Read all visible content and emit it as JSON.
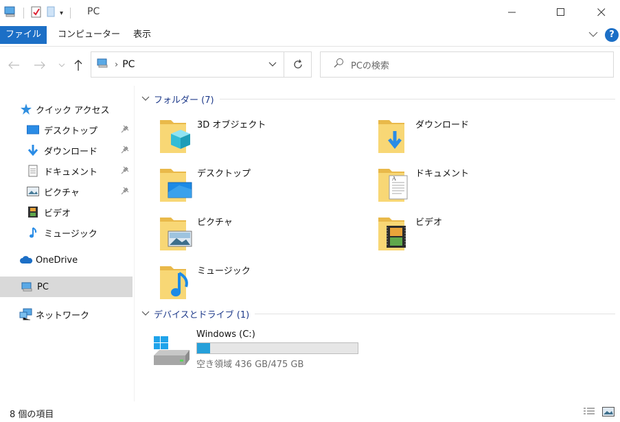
{
  "window": {
    "title": "PC"
  },
  "ribbon": {
    "tabs": [
      "ファイル",
      "コンピューター",
      "表示"
    ],
    "help": "?"
  },
  "address": {
    "crumb_separator": "›",
    "path": "PC"
  },
  "search": {
    "placeholder": "PCの検索"
  },
  "sidebar": {
    "quick_access": "クイック アクセス",
    "pinned": [
      {
        "label": "デスクトップ",
        "icon": "desktop-icon"
      },
      {
        "label": "ダウンロード",
        "icon": "download-arrow-icon"
      },
      {
        "label": "ドキュメント",
        "icon": "document-icon"
      },
      {
        "label": "ピクチャ",
        "icon": "picture-icon"
      }
    ],
    "videos": "ビデオ",
    "music": "ミュージック",
    "onedrive": "OneDrive",
    "pc": "PC",
    "network": "ネットワーク"
  },
  "folders_group": {
    "title": "フォルダー (7)",
    "items": [
      {
        "name": "3D オブジェクト",
        "icon": "3d-objects-icon"
      },
      {
        "name": "ダウンロード",
        "icon": "downloads-folder-icon"
      },
      {
        "name": "デスクトップ",
        "icon": "desktop-folder-icon"
      },
      {
        "name": "ドキュメント",
        "icon": "documents-folder-icon"
      },
      {
        "name": "ピクチャ",
        "icon": "pictures-folder-icon"
      },
      {
        "name": "ビデオ",
        "icon": "videos-folder-icon"
      },
      {
        "name": "ミュージック",
        "icon": "music-folder-icon"
      }
    ]
  },
  "devices_group": {
    "title": "デバイスとドライブ (1)",
    "drive": {
      "name": "Windows (C:)",
      "space": "空き領域 436 GB/475 GB",
      "used_fraction": 0.08
    }
  },
  "status": {
    "count": "8 個の項目"
  },
  "colors": {
    "accent": "#1c6fc6",
    "folder": "#f8d775",
    "group_title": "#1e3a8a",
    "progress": "#26a0da"
  }
}
